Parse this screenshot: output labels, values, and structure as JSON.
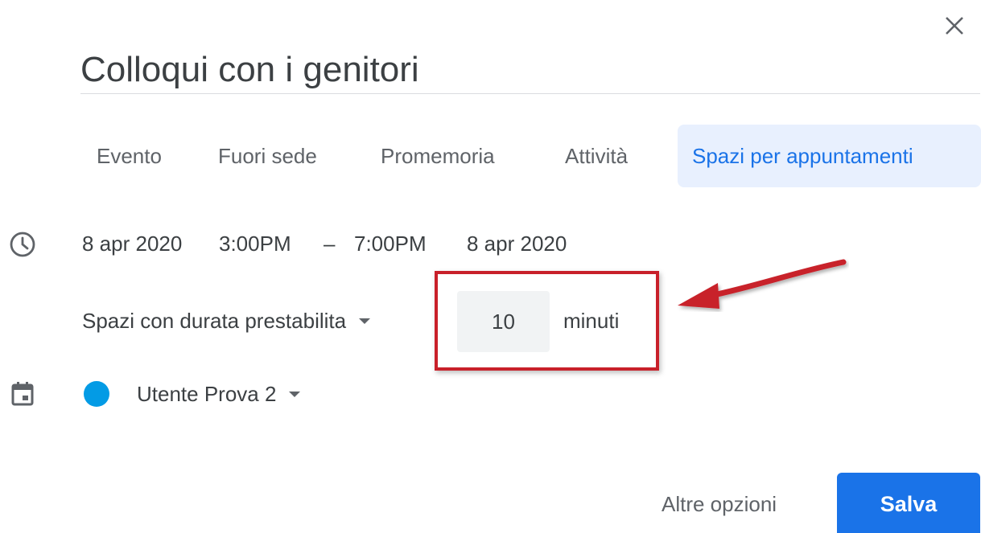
{
  "dialog": {
    "title": "Colloqui con i genitori",
    "close_icon": "close-icon"
  },
  "tabs": [
    {
      "label": "Evento",
      "active": false
    },
    {
      "label": "Fuori sede",
      "active": false
    },
    {
      "label": "Promemoria",
      "active": false
    },
    {
      "label": "Attività",
      "active": false
    },
    {
      "label": "Spazi per appuntamenti",
      "active": true
    }
  ],
  "datetime": {
    "icon": "clock-icon",
    "start_date": "8 apr 2020",
    "start_time": "3:00PM",
    "separator": "–",
    "end_time": "7:00PM",
    "end_date": "8 apr 2020"
  },
  "slots": {
    "mode_label": "Spazi con durata prestabilita",
    "duration_value": "10",
    "unit_label": "minuti"
  },
  "calendar": {
    "icon": "calendar-icon",
    "name": "Utente Prova 2",
    "color": "#039be5"
  },
  "annotation": {
    "highlight_color": "#c8202a",
    "arrow_icon": "red-arrow-icon"
  },
  "actions": {
    "more_options_label": "Altre opzioni",
    "save_label": "Salva"
  },
  "colors": {
    "accent": "#1a73e8",
    "active_tab_bg": "#e8f0fe"
  }
}
